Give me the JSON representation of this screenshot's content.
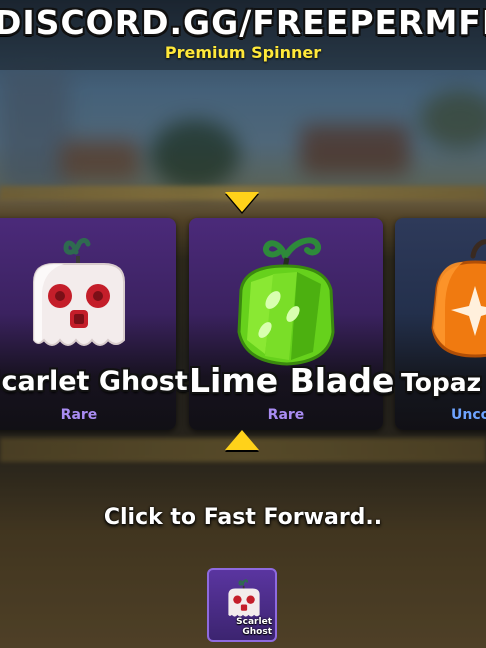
{
  "header": {
    "banner": "DISCORD.GG/FREEPERMFRUITS",
    "title": "Premium Spinner"
  },
  "cards": [
    {
      "name": "Scarlet Ghost",
      "rarity": "Rare",
      "icon": "ghost-fruit-icon"
    },
    {
      "name": "Lime Blade",
      "rarity": "Rare",
      "icon": "blade-fruit-icon"
    },
    {
      "name": "Topaz D",
      "rarity": "Unco",
      "icon": "orange-fruit-icon"
    }
  ],
  "prompt": "Click to Fast Forward..",
  "result": {
    "label_line1": "Scarlet",
    "label_line2": "Ghost",
    "icon": "ghost-fruit-icon"
  },
  "colors": {
    "accent_yellow": "#ffd21a",
    "card_purple": "#4b2a7a",
    "rarity_rare": "#a98cf2",
    "rarity_uncommon": "#6ea4ff"
  }
}
